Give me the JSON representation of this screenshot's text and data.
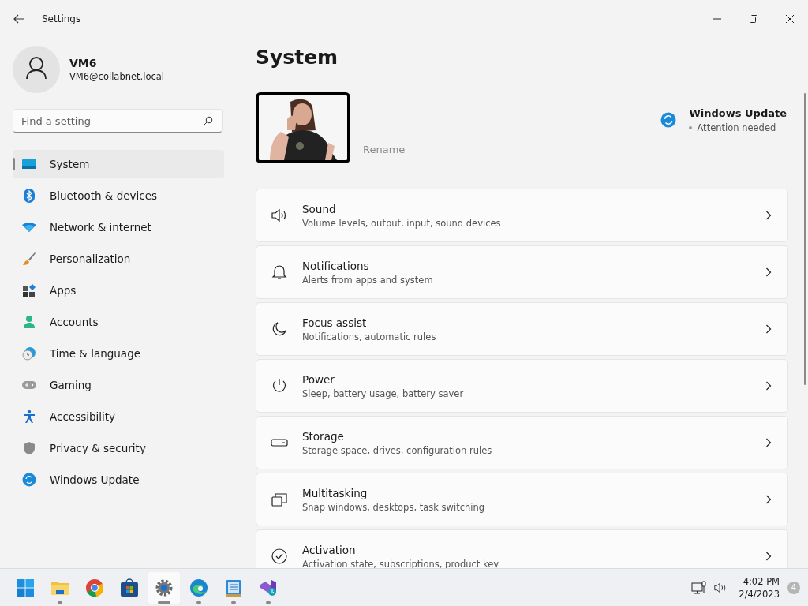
{
  "window": {
    "title": "Settings"
  },
  "account": {
    "name": "VM6",
    "email": "VM6@collabnet.local"
  },
  "search": {
    "placeholder": "Find a setting"
  },
  "nav": [
    {
      "label": "System",
      "selected": true
    },
    {
      "label": "Bluetooth & devices",
      "selected": false
    },
    {
      "label": "Network & internet",
      "selected": false
    },
    {
      "label": "Personalization",
      "selected": false
    },
    {
      "label": "Apps",
      "selected": false
    },
    {
      "label": "Accounts",
      "selected": false
    },
    {
      "label": "Time & language",
      "selected": false
    },
    {
      "label": "Gaming",
      "selected": false
    },
    {
      "label": "Accessibility",
      "selected": false
    },
    {
      "label": "Privacy & security",
      "selected": false
    },
    {
      "label": "Windows Update",
      "selected": false
    }
  ],
  "page": {
    "title": "System",
    "device": {
      "rename": "Rename"
    },
    "update": {
      "title": "Windows Update",
      "status": "Attention needed"
    }
  },
  "cards": [
    {
      "title": "Sound",
      "subtitle": "Volume levels, output, input, sound devices"
    },
    {
      "title": "Notifications",
      "subtitle": "Alerts from apps and system"
    },
    {
      "title": "Focus assist",
      "subtitle": "Notifications, automatic rules"
    },
    {
      "title": "Power",
      "subtitle": "Sleep, battery usage, battery saver"
    },
    {
      "title": "Storage",
      "subtitle": "Storage space, drives, configuration rules"
    },
    {
      "title": "Multitasking",
      "subtitle": "Snap windows, desktops, task switching"
    },
    {
      "title": "Activation",
      "subtitle": "Activation state, subscriptions, product key"
    }
  ],
  "taskbar": {
    "apps": [
      {
        "running": false,
        "selected": false
      },
      {
        "running": true,
        "selected": false
      },
      {
        "running": false,
        "selected": false
      },
      {
        "running": false,
        "selected": false
      },
      {
        "running": true,
        "selected": true
      },
      {
        "running": true,
        "selected": false
      },
      {
        "running": true,
        "selected": false
      },
      {
        "running": true,
        "selected": false
      }
    ],
    "time": "4:02 PM",
    "date": "2/4/2023",
    "notifications": "4"
  }
}
